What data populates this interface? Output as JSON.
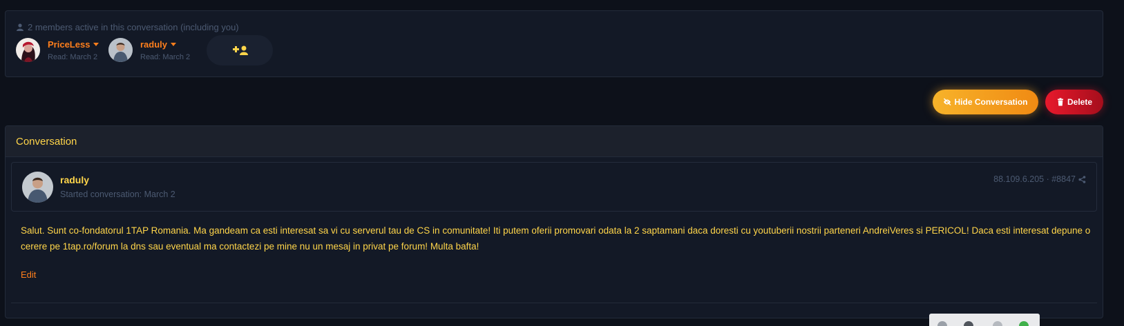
{
  "members": {
    "header": "2 members active in this conversation (including you)",
    "list": [
      {
        "name": "PriceLess",
        "read": "Read: March 2"
      },
      {
        "name": "raduly",
        "read": "Read: March 2"
      }
    ]
  },
  "actions": {
    "hide_label": "Hide Conversation",
    "delete_label": "Delete"
  },
  "conversation": {
    "title": "Conversation",
    "message": {
      "author": "raduly",
      "started": "Started conversation: March 2",
      "meta": "88.109.6.205 · #8847",
      "body": "Salut. Sunt co-fondatorul 1TAP Romania. Ma gandeam ca esti interesat sa vi cu serverul tau de CS in comunitate! Iti putem oferii promovari odata la 2 saptamani daca doresti cu youtuberii nostrii parteneri AndreiVeres si PERICOL! Daca esti interesat depune o cerere pe 1tap.ro/forum la dns sau eventual ma contactezi pe mine nu un mesaj in privat pe forum! Multa bafta!",
      "edit_label": "Edit"
    }
  },
  "colors": {
    "accent_yellow": "#ffd54a",
    "accent_orange": "#ff7f1c",
    "muted": "#4c5a72",
    "delete_red": "#e8192c"
  }
}
